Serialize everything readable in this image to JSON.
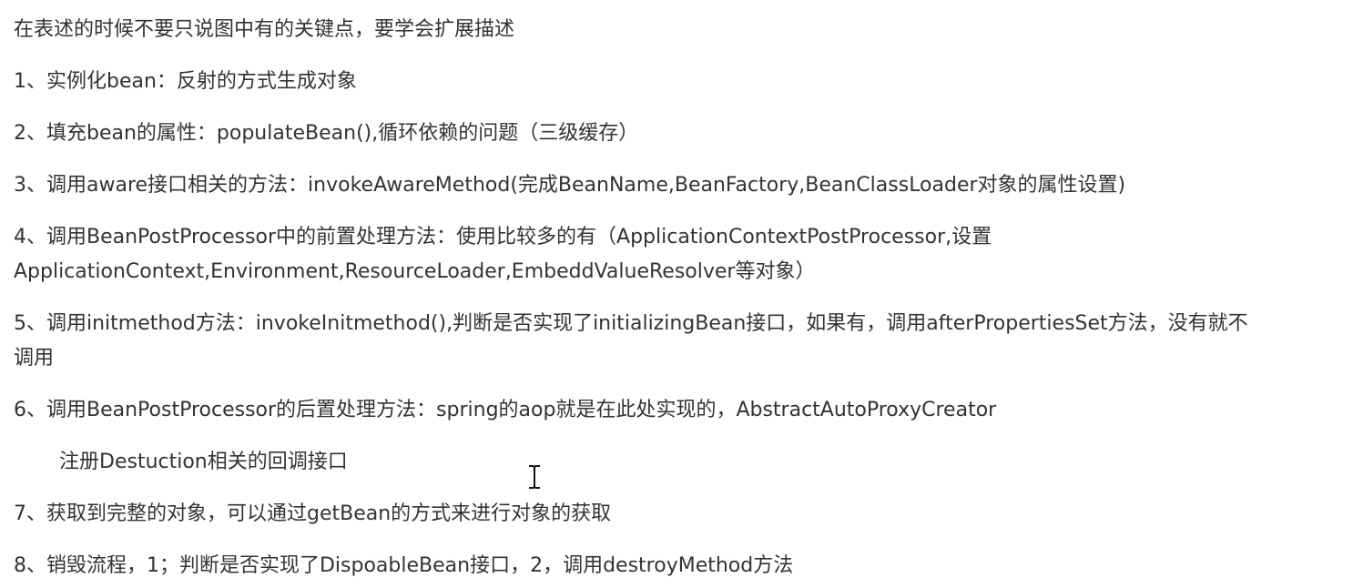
{
  "document": {
    "paragraphs": [
      {
        "id": "intro",
        "text": "在表述的时候不要只说图中有的关键点，要学会扩展描述"
      },
      {
        "id": "step-1",
        "text": "1、实例化bean：反射的方式生成对象"
      },
      {
        "id": "step-2",
        "text": "2、填充bean的属性：populateBean(),循环依赖的问题（三级缓存）"
      },
      {
        "id": "step-3",
        "text": "3、调用aware接口相关的方法：invokeAwareMethod(完成BeanName,BeanFactory,BeanClassLoader对象的属性设置)"
      },
      {
        "id": "step-4",
        "lines": [
          "4、调用BeanPostProcessor中的前置处理方法：使用比较多的有（ApplicationContextPostProcessor,设置",
          "ApplicationContext,Environment,ResourceLoader,EmbeddValueResolver等对象）"
        ]
      },
      {
        "id": "step-5",
        "lines": [
          "5、调用initmethod方法：invokeInitmethod(),判断是否实现了initializingBean接口，如果有，调用afterPropertiesSet方法，没有就不",
          "调用"
        ]
      },
      {
        "id": "step-6",
        "text": "6、调用BeanPostProcessor的后置处理方法：spring的aop就是在此处实现的，AbstractAutoProxyCreator"
      },
      {
        "id": "step-6-note",
        "text": "注册Destuction相关的回调接口"
      },
      {
        "id": "step-7",
        "text": "7、获取到完整的对象，可以通过getBean的方式来进行对象的获取"
      },
      {
        "id": "step-8",
        "text": "8、销毁流程，1；判断是否实现了DispoableBean接口，2，调用destroyMethod方法"
      }
    ]
  },
  "cursor": {
    "icon": "text-cursor-icon"
  }
}
